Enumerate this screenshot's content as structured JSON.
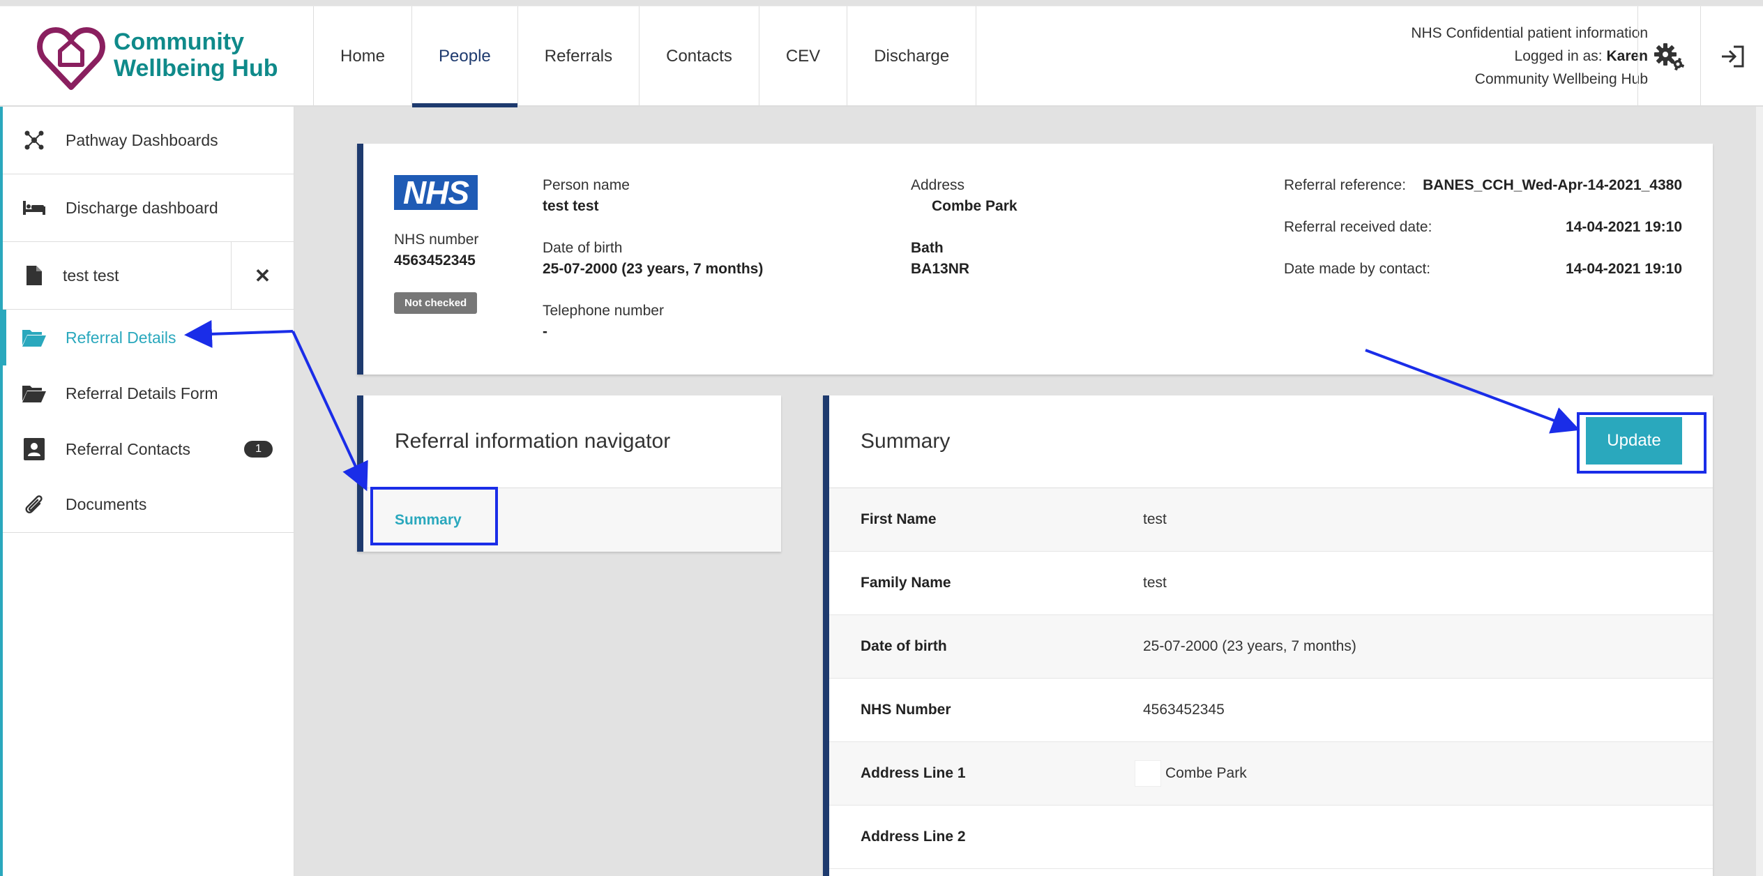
{
  "brand": {
    "line1": "Community",
    "line2": "Wellbeing Hub",
    "color": "#0f8a8a",
    "logo_icon": "heart-house-icon"
  },
  "nav": {
    "tabs": [
      "Home",
      "People",
      "Referrals",
      "Contacts",
      "CEV",
      "Discharge"
    ],
    "active": "People"
  },
  "user_info": {
    "line1": "NHS Confidential patient information",
    "logged_in_prefix": "Logged in as: ",
    "user": "Karen",
    "line3": "Community Wellbeing Hub"
  },
  "header_icons": [
    "gears-icon",
    "sign-out-icon"
  ],
  "sidebar": {
    "pathway": "Pathway Dashboards",
    "discharge": "Discharge dashboard",
    "person": "test test",
    "close": "✕",
    "sub_items": [
      {
        "label": "Referral Details",
        "icon": "folder-open-icon",
        "active": true
      },
      {
        "label": "Referral Details Form",
        "icon": "folder-open-icon"
      },
      {
        "label": "Referral Contacts",
        "icon": "contact-card-icon",
        "badge": "1"
      },
      {
        "label": "Documents",
        "icon": "paperclip-icon"
      }
    ]
  },
  "patient": {
    "nhs_logo": "NHS",
    "nhs_number_label": "NHS number",
    "nhs_number": "4563452345",
    "status_badge": "Not checked",
    "person_name_label": "Person name",
    "person_name": "test test",
    "dob_label": "Date of birth",
    "dob": "25-07-2000 (23 years, 7 months)",
    "phone_label": "Telephone number",
    "phone": "-",
    "address_label": "Address",
    "address_line1": "Combe Park",
    "address_city": "Bath",
    "address_postcode": "BA13NR",
    "ref_label": "Referral reference:",
    "ref_value": "BANES_CCH_Wed-Apr-14-2021_4380",
    "received_label": "Referral received date:",
    "received_value": "14-04-2021 19:10",
    "contact_label": "Date made by contact:",
    "contact_value": "14-04-2021 19:10"
  },
  "navigator": {
    "title": "Referral information navigator",
    "link": "Summary"
  },
  "summary": {
    "title": "Summary",
    "update_label": "Update",
    "rows": [
      {
        "key": "First Name",
        "value": "test"
      },
      {
        "key": "Family Name",
        "value": "test"
      },
      {
        "key": "Date of birth",
        "value": "25-07-2000 (23 years, 7 months)"
      },
      {
        "key": "NHS Number",
        "value": "4563452345"
      },
      {
        "key": "Address Line 1",
        "value": "Combe Park"
      },
      {
        "key": "Address Line 2",
        "value": ""
      }
    ]
  },
  "colors": {
    "accent": "#2aa8bd",
    "navy": "#1e3a6e",
    "annotation": "#1a2de8",
    "nhs_blue": "#1f5bb5"
  }
}
